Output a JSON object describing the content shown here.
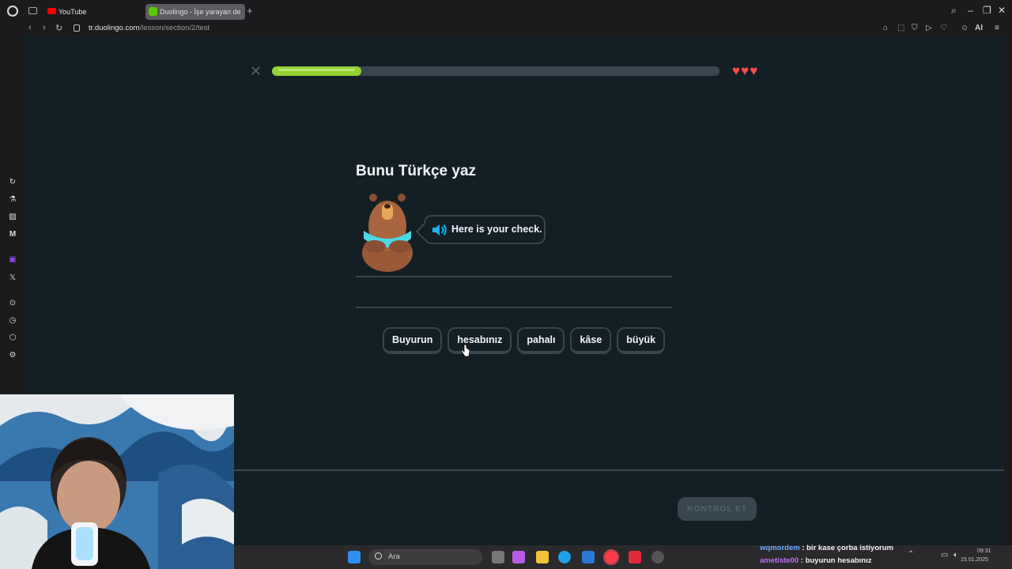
{
  "browser": {
    "tabs": [
      {
        "label": "YouTube"
      },
      {
        "label": "Duolingo - İşe yarayan de"
      }
    ],
    "new_tab": "+",
    "url_host": "tr.duolingo.com",
    "url_path": "/lesson/section/2/test",
    "ai_label": "AI"
  },
  "lesson": {
    "progress": 0.2,
    "lives": 3,
    "prompt_title": "Bunu Türkçe yaz",
    "speech_text": "Here is your check.",
    "word_bank": [
      "Buyurun",
      "hesabınız",
      "pahalı",
      "kâse",
      "büyük"
    ],
    "check_button": "KONTROL ET"
  },
  "taskbar": {
    "search_placeholder": "Ara",
    "time": "09:31",
    "date": "15.01.2025"
  },
  "chat": [
    {
      "user": "wqmordem",
      "message": ": bir kase çorba istiyorum"
    },
    {
      "user": "ametiste00",
      "message": ": buyurun hesabınız"
    }
  ],
  "colors": {
    "background": "#131f24",
    "border": "#37464f",
    "progress_fill": "#93d333",
    "heart": "#ff4b4b",
    "speaker": "#1cb0f6"
  }
}
